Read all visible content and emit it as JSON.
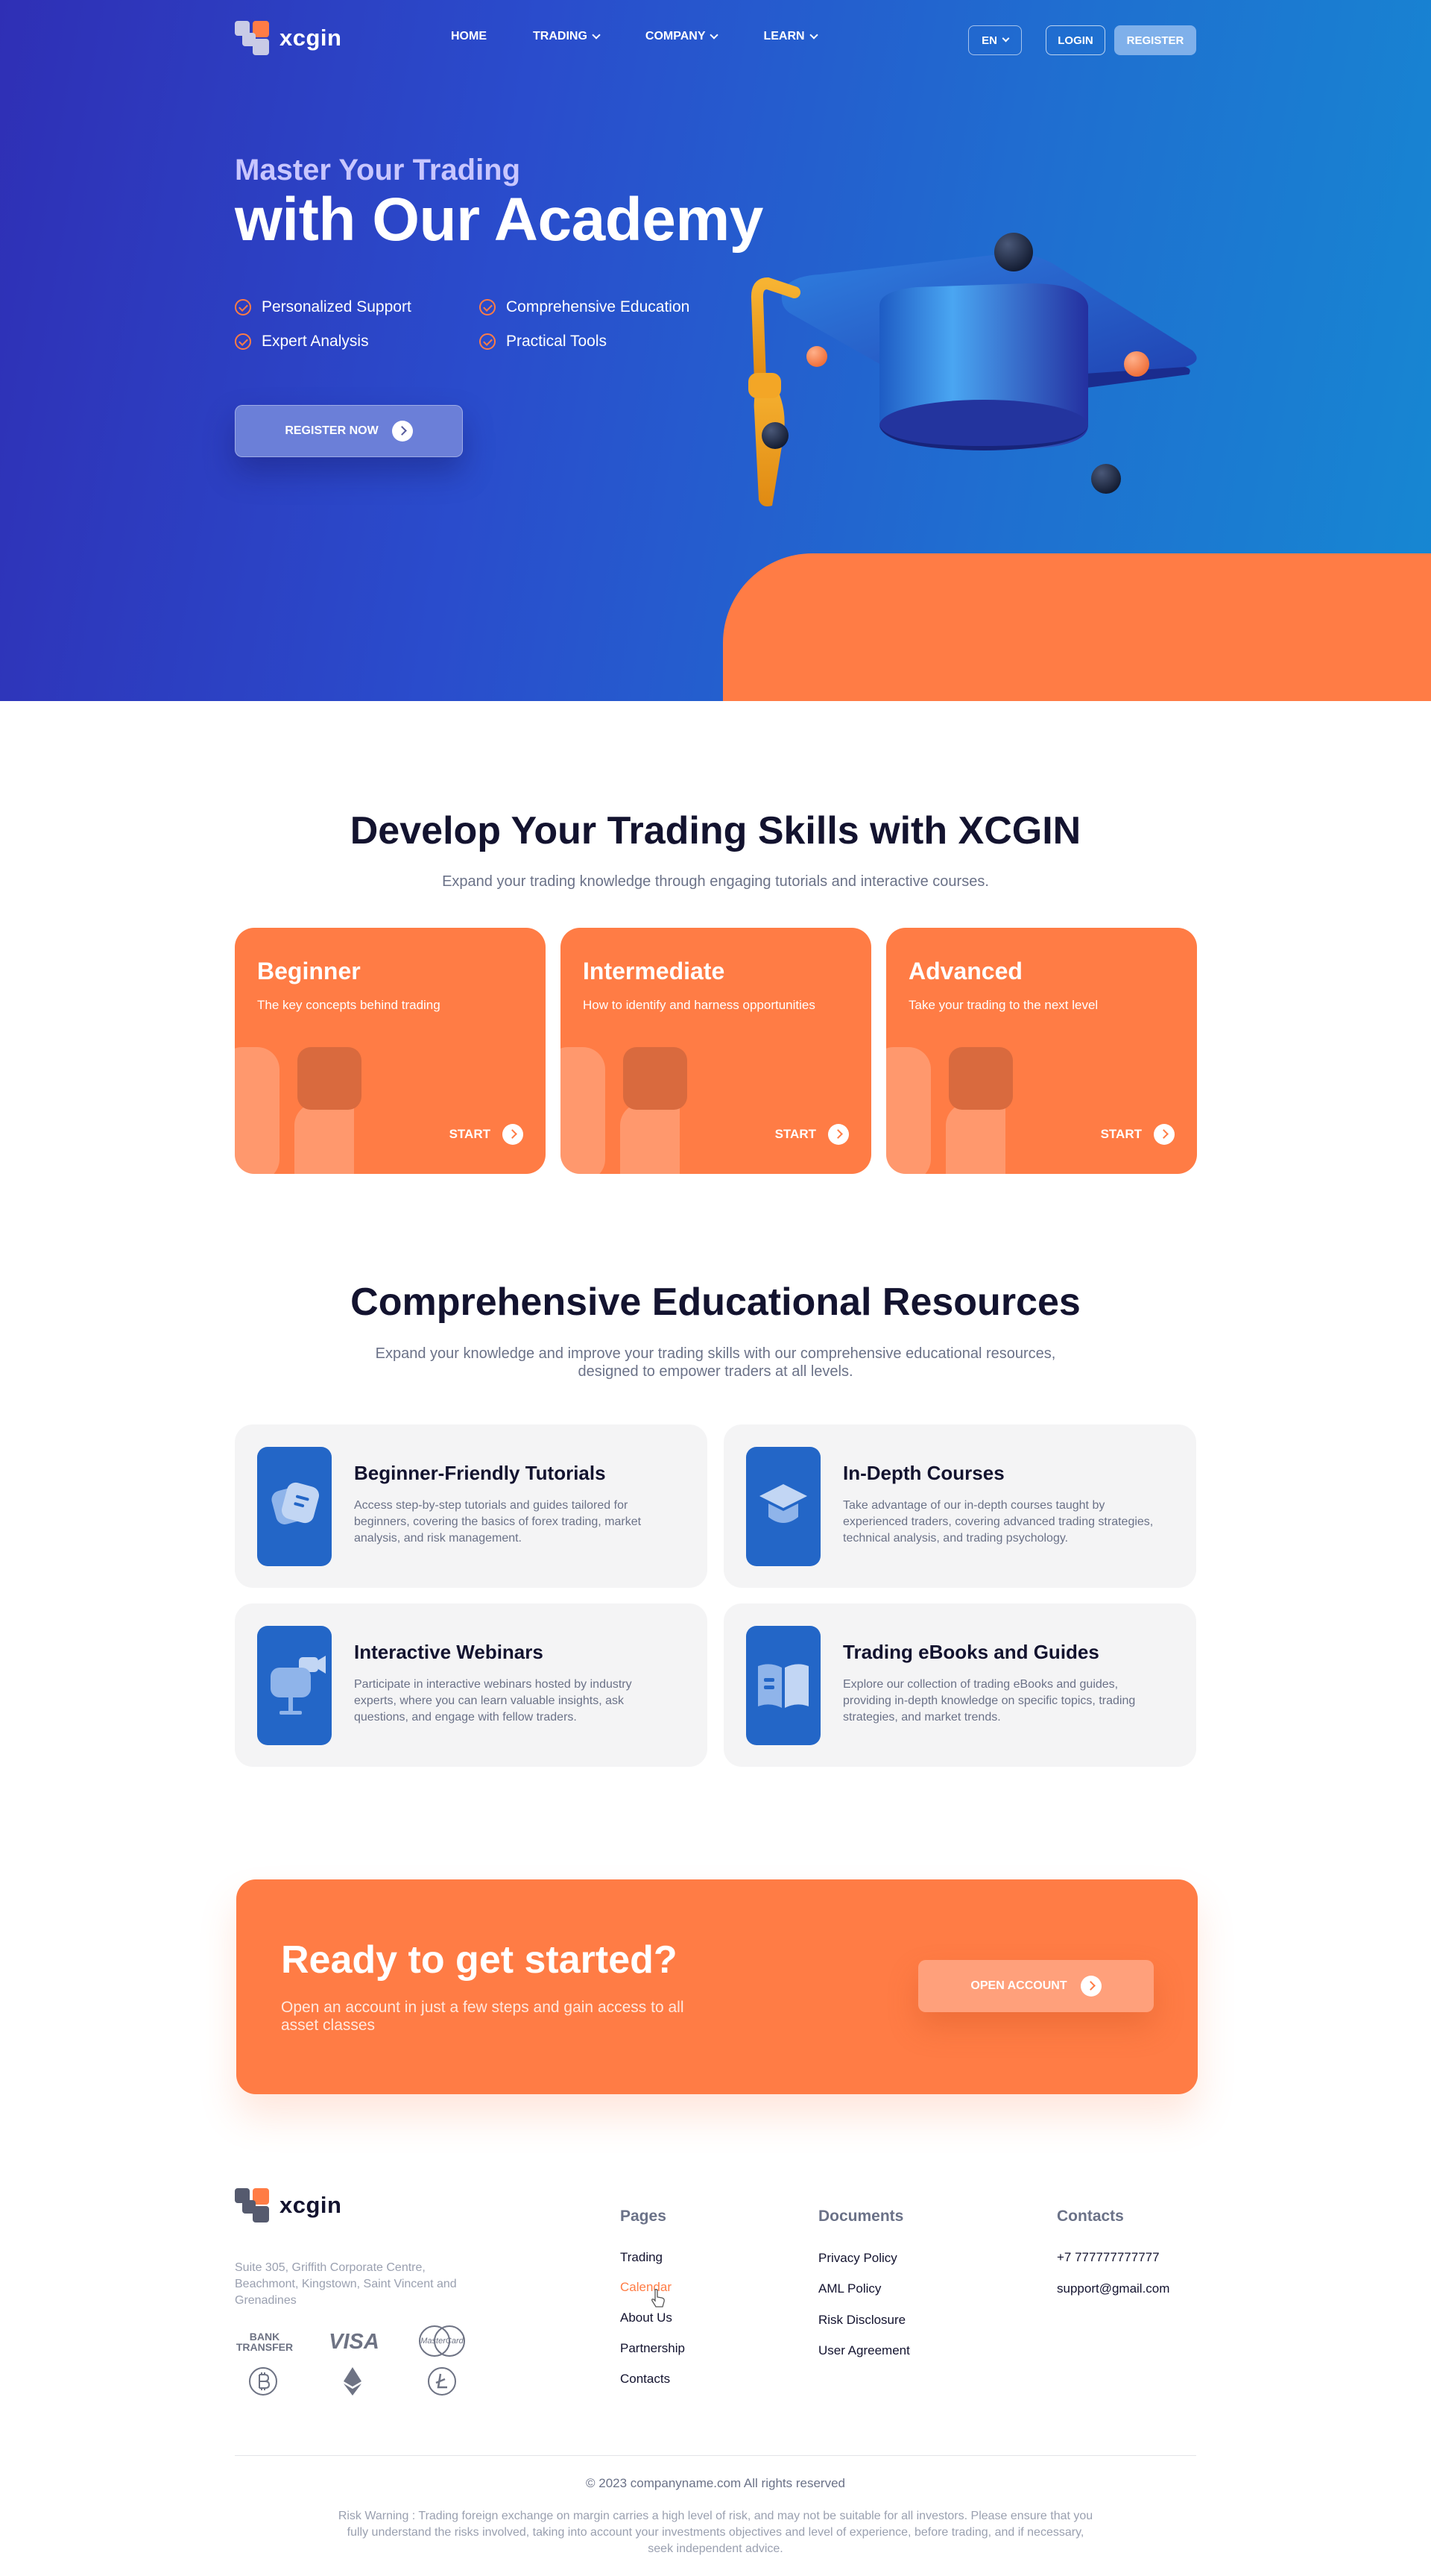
{
  "brand": {
    "name": "xcgin",
    "colors": {
      "primary_blue": "#2366c7",
      "accent_orange": "#ff7c45",
      "dark": "#13132f"
    }
  },
  "nav": {
    "items": [
      {
        "label": "HOME",
        "dropdown": false
      },
      {
        "label": "TRADING",
        "dropdown": true
      },
      {
        "label": "COMPANY",
        "dropdown": true
      },
      {
        "label": "LEARN",
        "dropdown": true
      }
    ],
    "language": "EN",
    "login_label": "LOGIN",
    "register_label": "REGISTER"
  },
  "hero": {
    "subtitle": "Master Your Trading",
    "title": "with Our Academy",
    "features": [
      "Personalized Support",
      "Comprehensive Education",
      "Expert Analysis",
      "Practical Tools"
    ],
    "cta_label": "REGISTER NOW"
  },
  "skills": {
    "title": "Develop Your Trading Skills with XCGIN",
    "subtitle": "Expand your trading knowledge through engaging tutorials and interactive courses.",
    "cards": [
      {
        "title": "Beginner",
        "text": "The key concepts behind trading",
        "cta": "START"
      },
      {
        "title": "Intermediate",
        "text": "How to identify and harness opportunities",
        "cta": "START"
      },
      {
        "title": "Advanced",
        "text": "Take your trading to the next level",
        "cta": "START"
      }
    ]
  },
  "resources": {
    "title": "Comprehensive Educational Resources",
    "subtitle_line1": "Expand your knowledge and improve your trading skills with our comprehensive educational resources,",
    "subtitle_line2": "designed to empower traders at all levels.",
    "items": [
      {
        "title": "Beginner-Friendly Tutorials",
        "icon": "chat-bubbles-icon",
        "text": "Access step-by-step tutorials and guides tailored for beginners, covering the basics of forex trading, market analysis, and risk management."
      },
      {
        "title": "In-Depth Courses",
        "icon": "graduation-cap-icon",
        "text": "Take advantage of our in-depth courses taught by experienced traders, covering advanced trading strategies, technical analysis, and trading psychology."
      },
      {
        "title": "Interactive Webinars",
        "icon": "webinar-presenter-icon",
        "text": "Participate in interactive webinars hosted by industry experts, where you can learn valuable insights, ask questions, and engage with fellow traders."
      },
      {
        "title": "Trading eBooks and Guides",
        "icon": "open-book-icon",
        "text": "Explore our collection of trading eBooks and guides, providing in-depth knowledge on specific topics, trading strategies, and market trends."
      }
    ]
  },
  "cta": {
    "title": "Ready to get started?",
    "text": "Open an account in just a few steps and gain access to all asset classes",
    "button_label": "OPEN ACCOUNT"
  },
  "footer": {
    "address": "Suite 305, Griffith Corporate Centre, Beachmont, Kingstown, Saint Vincent and Grenadines",
    "payments": {
      "bank_top": "BANK",
      "bank_bottom": "TRANSFER",
      "visa": "VISA",
      "mastercard": "MasterCard"
    },
    "columns": [
      {
        "title": "Pages",
        "links": [
          "Trading",
          "Calendar",
          "About Us",
          "Partnership",
          "Contacts"
        ]
      },
      {
        "title": "Documents",
        "links": [
          "Privacy Policy",
          "AML Policy",
          "Risk Disclosure",
          "User Agreement"
        ]
      },
      {
        "title": "Contacts",
        "links": [
          "+7 777777777777",
          "support@gmail.com"
        ]
      }
    ],
    "active_link": "Calendar",
    "copyright": "© 2023 companyname.com All rights reserved",
    "risk_warning": "Risk Warning : Trading foreign exchange on margin carries a high level of risk, and may not be suitable for all investors. Please ensure that you fully understand the risks involved, taking into account your investments objectives and level of experience, before trading, and if necessary, seek independent advice."
  }
}
